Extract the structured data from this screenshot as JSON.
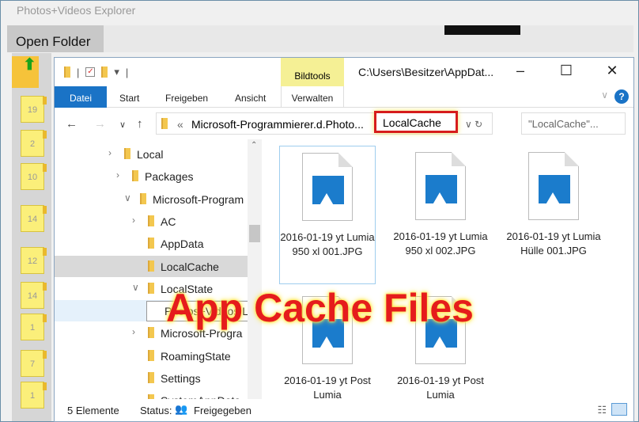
{
  "app": {
    "title": "Photos+Videos Explorer",
    "open_folder": "Open Folder"
  },
  "tiles": [
    "19",
    "2",
    "10",
    "14",
    "12",
    "14",
    "1",
    "7",
    "1"
  ],
  "explorer": {
    "context_tab": "Bildtools",
    "window_title": "C:\\Users\\Besitzer\\AppDat...",
    "tabs": [
      "Datei",
      "Start",
      "Freigeben",
      "Ansicht",
      "Verwalten"
    ],
    "address": {
      "prefix": "«",
      "path": "Microsoft-Programmierer.d.Photo...",
      "current": "LocalCache",
      "sep": "›"
    },
    "search_placeholder": "\"LocalCache\"...",
    "tree": [
      {
        "label": "Local",
        "indent": 0,
        "chev": ">"
      },
      {
        "label": "Packages",
        "indent": 1,
        "chev": ">"
      },
      {
        "label": "Microsoft-Program",
        "indent": 2,
        "chev": "v"
      },
      {
        "label": "AC",
        "indent": 3,
        "chev": ">"
      },
      {
        "label": "AppData",
        "indent": 3,
        "chev": ""
      },
      {
        "label": "LocalCache",
        "indent": 3,
        "chev": "",
        "selected": true
      },
      {
        "label": "LocalState",
        "indent": 3,
        "chev": "v"
      },
      {
        "label": "Photos+Videos Light",
        "indent": 4,
        "chev": "",
        "editing": true
      },
      {
        "label": "Microsoft-Progra",
        "indent": 3,
        "chev": ">"
      },
      {
        "label": "RoamingState",
        "indent": 3,
        "chev": ""
      },
      {
        "label": "Settings",
        "indent": 3,
        "chev": ""
      },
      {
        "label": "SystemAppData",
        "indent": 3,
        "chev": ""
      }
    ],
    "files": [
      {
        "name": "2016-01-19 yt Lumia 950 xl 001.JPG",
        "selected": true
      },
      {
        "name": "2016-01-19 yt Lumia 950 xl 002.JPG"
      },
      {
        "name": "2016-01-19 yt Lumia Hülle 001.JPG"
      },
      {
        "name": "2016-01-19 yt Post Lumia"
      },
      {
        "name": "2016-01-19 yt Post Lumia"
      }
    ],
    "status": {
      "count": "5 Elemente",
      "label": "Status:",
      "value": "Freigegeben"
    }
  },
  "overlay": "App Cache Files"
}
